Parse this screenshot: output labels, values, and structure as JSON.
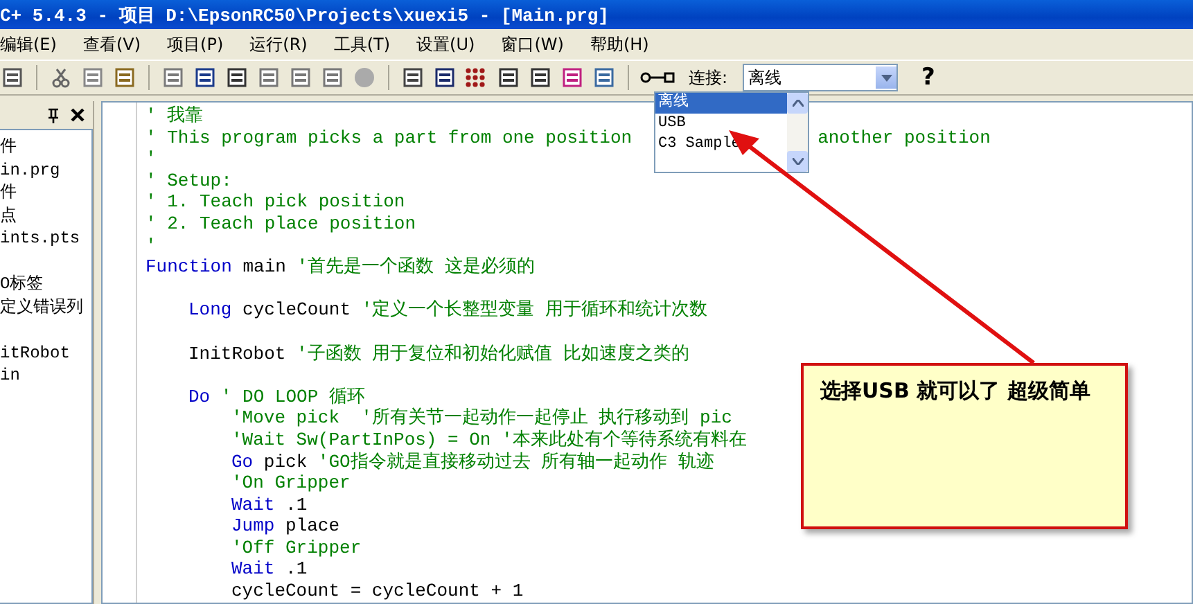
{
  "window": {
    "title": "C+ 5.4.3 - 项目 D:\\EpsonRC50\\Projects\\xuexi5 - [Main.prg]"
  },
  "menu": [
    "编辑(E)",
    "查看(V)",
    "项目(P)",
    "运行(R)",
    "工具(T)",
    "设置(U)",
    "窗口(W)",
    "帮助(H)"
  ],
  "toolbar": {
    "connection_label": "连接:",
    "connection_value": "离线",
    "help": "?"
  },
  "connection_list": [
    {
      "label": "离线",
      "selected": true
    },
    {
      "label": "USB",
      "selected": false
    },
    {
      "label": "C3 Sample",
      "selected": false
    }
  ],
  "project_panel": {
    "items": [
      {
        "kind": "item",
        "text": "件"
      },
      {
        "kind": "item",
        "text": "in.prg"
      },
      {
        "kind": "item",
        "text": "件"
      },
      {
        "kind": "item",
        "text": "点"
      },
      {
        "kind": "item",
        "text": "ints.pts"
      },
      {
        "kind": "blank"
      },
      {
        "kind": "item",
        "text": "O标签"
      },
      {
        "kind": "item",
        "text": "定义错误列"
      },
      {
        "kind": "blank"
      },
      {
        "kind": "item",
        "text": "itRobot"
      },
      {
        "kind": "item",
        "text": "in"
      }
    ]
  },
  "code_lines": [
    {
      "kind": "top",
      "tokens": [
        {
          "kind": "comment",
          "text": "' 我靠"
        }
      ]
    },
    {
      "kind": "top",
      "tokens": [
        {
          "kind": "comment",
          "text": "' This program picks a part from one position"
        },
        {
          "kind": "comment",
          "text": "another position",
          "after_gap": true
        }
      ]
    },
    {
      "kind": "top",
      "tokens": [
        {
          "kind": "comment",
          "text": "'"
        }
      ]
    },
    {
      "kind": "top",
      "tokens": [
        {
          "kind": "comment",
          "text": "' Setup:"
        }
      ]
    },
    {
      "kind": "top",
      "tokens": [
        {
          "kind": "comment",
          "text": "' 1. Teach pick position"
        }
      ]
    },
    {
      "kind": "top",
      "tokens": [
        {
          "kind": "comment",
          "text": "' 2. Teach place position"
        }
      ]
    },
    {
      "kind": "top",
      "tokens": [
        {
          "kind": "comment",
          "text": "'"
        }
      ]
    },
    {
      "kind": "top",
      "tokens": [
        {
          "kind": "keyword",
          "text": "Function"
        },
        {
          "kind": "plain",
          "text": " main "
        },
        {
          "kind": "comment",
          "text": "'首先是一个函数 这是必须的"
        }
      ]
    },
    {
      "kind": "blank"
    },
    {
      "kind": "body",
      "tokens": [
        {
          "kind": "keyword",
          "text": "Long"
        },
        {
          "kind": "plain",
          "text": " cycleCount "
        },
        {
          "kind": "comment",
          "text": "'定义一个长整型变量 用于循环和统计次数"
        }
      ]
    },
    {
      "kind": "blank"
    },
    {
      "kind": "body",
      "tokens": [
        {
          "kind": "plain",
          "text": "InitRobot "
        },
        {
          "kind": "comment",
          "text": "'子函数 用于复位和初始化赋值 比如速度之类的"
        }
      ]
    },
    {
      "kind": "blank"
    },
    {
      "kind": "body",
      "tokens": [
        {
          "kind": "keyword",
          "text": "Do"
        },
        {
          "kind": "comment",
          "text": " ' DO LOOP 循环"
        }
      ]
    },
    {
      "kind": "loop",
      "tokens": [
        {
          "kind": "comment",
          "text": "'Move pick  '所有关节一起动作一起停止 执行移动到 pic"
        }
      ]
    },
    {
      "kind": "loop",
      "tokens": [
        {
          "kind": "comment",
          "text": "'Wait Sw(PartInPos) = On '本来此处有个等待系统有料在"
        }
      ]
    },
    {
      "kind": "loop",
      "tokens": [
        {
          "kind": "keyword",
          "text": "Go"
        },
        {
          "kind": "plain",
          "text": " pick "
        },
        {
          "kind": "comment",
          "text": "'GO指令就是直接移动过去 所有轴一起动作 轨迹"
        }
      ]
    },
    {
      "kind": "loop",
      "tokens": [
        {
          "kind": "comment",
          "text": "'On Gripper"
        }
      ]
    },
    {
      "kind": "loop",
      "tokens": [
        {
          "kind": "keyword",
          "text": "Wait"
        },
        {
          "kind": "plain",
          "text": " .1"
        }
      ]
    },
    {
      "kind": "loop",
      "tokens": [
        {
          "kind": "keyword",
          "text": "Jump"
        },
        {
          "kind": "plain",
          "text": " place"
        }
      ]
    },
    {
      "kind": "loop",
      "tokens": [
        {
          "kind": "comment",
          "text": "'Off Gripper"
        }
      ]
    },
    {
      "kind": "loop",
      "tokens": [
        {
          "kind": "keyword",
          "text": "Wait"
        },
        {
          "kind": "plain",
          "text": " .1"
        }
      ]
    },
    {
      "kind": "loop",
      "tokens": [
        {
          "kind": "plain",
          "text": "cycleCount = cycleCount + 1"
        }
      ]
    }
  ],
  "callout": {
    "text": "选择USB 就可以了 超级简单"
  }
}
